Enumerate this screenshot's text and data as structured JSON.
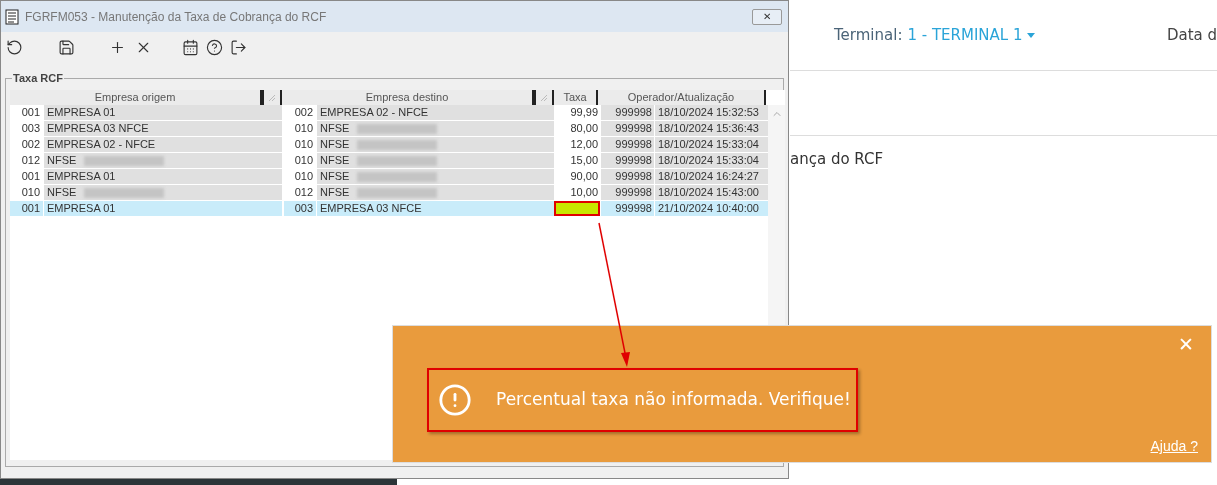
{
  "page": {
    "terminal_label": "Terminal:",
    "terminal_value": "1 - TERMINAL 1",
    "date_label": "Data d",
    "subtitle_fragment": "ança do RCF"
  },
  "window": {
    "title": "FGRFM053 - Manutenção da Taxa de Cobrança do RCF",
    "close": "✕"
  },
  "group": {
    "title": "Taxa RCF"
  },
  "table": {
    "columns": [
      "Empresa origem",
      "Empresa destino",
      "Taxa",
      "Operador/Atualização"
    ],
    "rows": [
      {
        "origin_code": "001",
        "origin_name": "EMPRESA 01",
        "origin_redacted": false,
        "dest_code": "002",
        "dest_name": "EMPRESA 02 - NFCE",
        "dest_redacted": false,
        "taxa": "99,99",
        "operator": "999998",
        "updated": "18/10/2024 15:32:53",
        "selected": false,
        "taxa_missing": false
      },
      {
        "origin_code": "003",
        "origin_name": "EMPRESA 03 NFCE",
        "origin_redacted": false,
        "dest_code": "010",
        "dest_name": "NFSE",
        "dest_redacted": true,
        "taxa": "80,00",
        "operator": "999998",
        "updated": "18/10/2024 15:36:43",
        "selected": false,
        "taxa_missing": false
      },
      {
        "origin_code": "002",
        "origin_name": "EMPRESA 02 - NFCE",
        "origin_redacted": false,
        "dest_code": "010",
        "dest_name": "NFSE",
        "dest_redacted": true,
        "taxa": "12,00",
        "operator": "999998",
        "updated": "18/10/2024 15:33:04",
        "selected": false,
        "taxa_missing": false
      },
      {
        "origin_code": "012",
        "origin_name": "NFSE",
        "origin_redacted": true,
        "dest_code": "010",
        "dest_name": "NFSE",
        "dest_redacted": true,
        "taxa": "15,00",
        "operator": "999998",
        "updated": "18/10/2024 15:33:04",
        "selected": false,
        "taxa_missing": false
      },
      {
        "origin_code": "001",
        "origin_name": "EMPRESA 01",
        "origin_redacted": false,
        "dest_code": "010",
        "dest_name": "NFSE",
        "dest_redacted": true,
        "taxa": "90,00",
        "operator": "999998",
        "updated": "18/10/2024 16:24:27",
        "selected": false,
        "taxa_missing": false
      },
      {
        "origin_code": "010",
        "origin_name": "NFSE",
        "origin_redacted": true,
        "dest_code": "012",
        "dest_name": "NFSE",
        "dest_redacted": true,
        "taxa": "10,00",
        "operator": "999998",
        "updated": "18/10/2024 15:43:00",
        "selected": false,
        "taxa_missing": false
      },
      {
        "origin_code": "001",
        "origin_name": "EMPRESA 01",
        "origin_redacted": false,
        "dest_code": "003",
        "dest_name": "EMPRESA 03 NFCE",
        "dest_redacted": false,
        "operator": "999998",
        "updated": "21/10/2024 10:40:00",
        "selected": true,
        "taxa_missing": true
      }
    ]
  },
  "toast": {
    "close": "✕",
    "message": "Percentual taxa não informada. Verifique!",
    "help_link": "Ajuda ?"
  }
}
